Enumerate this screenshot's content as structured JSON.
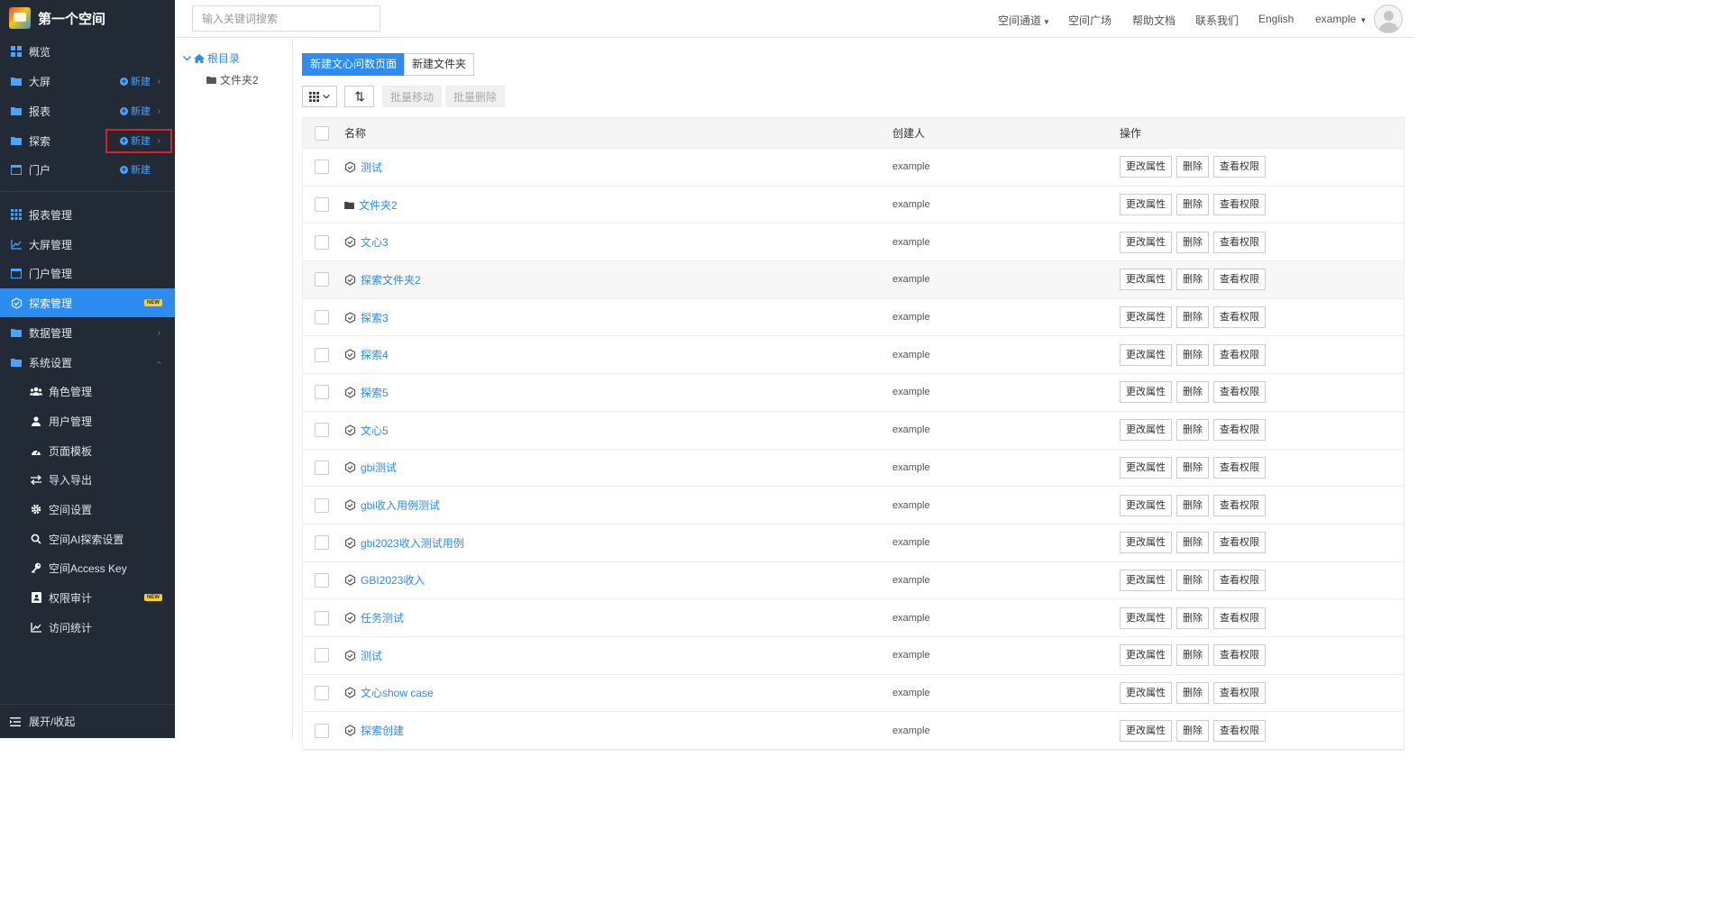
{
  "sidebar": {
    "brand": "第一个空间",
    "items": [
      {
        "label": "概览",
        "icon": "dashboard-icon"
      },
      {
        "label": "大屏",
        "icon": "folder-icon",
        "new": "新建"
      },
      {
        "label": "报表",
        "icon": "folder-icon",
        "new": "新建"
      },
      {
        "label": "探索",
        "icon": "folder-icon",
        "new": "新建"
      },
      {
        "label": "门户",
        "icon": "window-icon",
        "new": "新建"
      }
    ],
    "manage": [
      {
        "label": "报表管理",
        "icon": "grid-icon"
      },
      {
        "label": "大屏管理",
        "icon": "line-chart-icon"
      },
      {
        "label": "门户管理",
        "icon": "window-icon"
      },
      {
        "label": "探索管理",
        "icon": "cube-icon",
        "badge": "NEW",
        "active": true
      },
      {
        "label": "数据管理",
        "icon": "folder-icon"
      },
      {
        "label": "系统设置",
        "icon": "folder-icon"
      }
    ],
    "settings": [
      {
        "label": "角色管理",
        "icon": "users-icon"
      },
      {
        "label": "用户管理",
        "icon": "user-icon"
      },
      {
        "label": "页面模板",
        "icon": "gauge-icon"
      },
      {
        "label": "导入导出",
        "icon": "exchange-icon"
      },
      {
        "label": "空间设置",
        "icon": "gear-icon"
      },
      {
        "label": "空间AI探索设置",
        "icon": "search-icon"
      },
      {
        "label": "空间Access Key",
        "icon": "key-icon"
      },
      {
        "label": "权限审计",
        "icon": "audit-icon",
        "badge": "NEW"
      },
      {
        "label": "访问统计",
        "icon": "stats-icon"
      }
    ],
    "collapse_label": "展开/收起"
  },
  "topbar": {
    "search_placeholder": "输入关键词搜索",
    "links": [
      "空间通道",
      "空间广场",
      "帮助文档",
      "联系我们",
      "English",
      "example"
    ]
  },
  "tree": {
    "root": "根目录",
    "children": [
      "文件夹2"
    ]
  },
  "toolbar": {
    "new_page": "新建文心问数页面",
    "new_folder": "新建文件夹",
    "batch_move": "批量移动",
    "batch_delete": "批量删除"
  },
  "table": {
    "headers": {
      "name": "名称",
      "creator": "创建人",
      "actions": "操作"
    },
    "action_labels": [
      "更改属性",
      "删除",
      "查看权限"
    ],
    "rows": [
      {
        "name": "测试",
        "type": "explore",
        "creator": "example"
      },
      {
        "name": "文件夹2",
        "type": "folder",
        "creator": "example"
      },
      {
        "name": "文心3",
        "type": "explore",
        "creator": "example"
      },
      {
        "name": "探索文件夹2",
        "type": "explore",
        "creator": "example"
      },
      {
        "name": "探索3",
        "type": "explore",
        "creator": "example"
      },
      {
        "name": "探索4",
        "type": "explore",
        "creator": "example"
      },
      {
        "name": "探索5",
        "type": "explore",
        "creator": "example"
      },
      {
        "name": "文心5",
        "type": "explore",
        "creator": "example"
      },
      {
        "name": "gbi测试",
        "type": "explore",
        "creator": "example"
      },
      {
        "name": "gbi收入用例测试",
        "type": "explore",
        "creator": "example"
      },
      {
        "name": "gbi2023收入测试用例",
        "type": "explore",
        "creator": "example"
      },
      {
        "name": "GBI2023收入",
        "type": "explore",
        "creator": "example"
      },
      {
        "name": "任务测试",
        "type": "explore",
        "creator": "example"
      },
      {
        "name": "测试",
        "type": "explore",
        "creator": "example"
      },
      {
        "name": "文心show case",
        "type": "explore",
        "creator": "example"
      },
      {
        "name": "探索创建",
        "type": "explore",
        "creator": "example"
      }
    ]
  },
  "colors": {
    "accent": "#2d8cf0",
    "sidebar_bg": "#222a36",
    "highlight": "#e02020",
    "badge": "#f5d033"
  }
}
